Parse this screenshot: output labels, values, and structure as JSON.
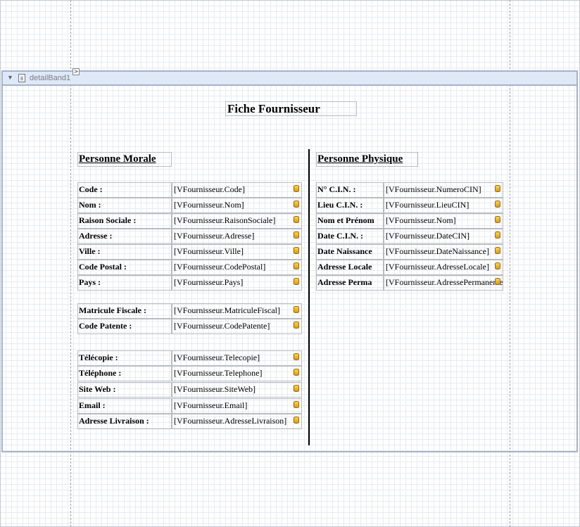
{
  "band": {
    "label": "detailBand1",
    "smart_tag": ">"
  },
  "report": {
    "title": "Fiche Fournisseur"
  },
  "morale": {
    "title": "Personne Morale",
    "rows": [
      {
        "label": "Code :",
        "field": "[VFournisseur.Code]"
      },
      {
        "label": "Nom :",
        "field": "[VFournisseur.Nom]"
      },
      {
        "label": "Raison Sociale :",
        "field": "[VFournisseur.RaisonSociale]"
      },
      {
        "label": "Adresse :",
        "field": "[VFournisseur.Adresse]"
      },
      {
        "label": "Ville :",
        "field": "[VFournisseur.Ville]"
      },
      {
        "label": "Code Postal :",
        "field": "[VFournisseur.CodePostal]"
      },
      {
        "label": "Pays :",
        "field": "[VFournisseur.Pays]"
      },
      {
        "label": "Matricule Fiscale :",
        "field": "[VFournisseur.MatriculeFiscal]"
      },
      {
        "label": "Code Patente :",
        "field": "[VFournisseur.CodePatente]"
      },
      {
        "label": "Télécopie :",
        "field": "[VFournisseur.Telecopie]"
      },
      {
        "label": "Téléphone :",
        "field": "[VFournisseur.Telephone]"
      },
      {
        "label": "Site Web :",
        "field": "[VFournisseur.SiteWeb]"
      },
      {
        "label": "Email :",
        "field": "[VFournisseur.Email]"
      },
      {
        "label": "Adresse Livraison :",
        "field": "[VFournisseur.AdresseLivraison]"
      }
    ]
  },
  "physique": {
    "title": "Personne Physique",
    "rows": [
      {
        "label": "N° C.I.N. :",
        "field": "[VFournisseur.NumeroCIN]"
      },
      {
        "label": "Lieu C.I.N. :",
        "field": "[VFournisseur.LieuCIN]"
      },
      {
        "label": "Nom et Prénom",
        "field": "[VFournisseur.Nom]"
      },
      {
        "label": "Date C.I.N. :",
        "field": "[VFournisseur.DateCIN]"
      },
      {
        "label": "Date Naissance",
        "field": "[VFournisseur.DateNaissance]"
      },
      {
        "label": "Adresse Locale",
        "field": "[VFournisseur.AdresseLocale]"
      },
      {
        "label": "Adresse Perma",
        "field": "[VFournisseur.AdressePermanente]"
      }
    ]
  }
}
